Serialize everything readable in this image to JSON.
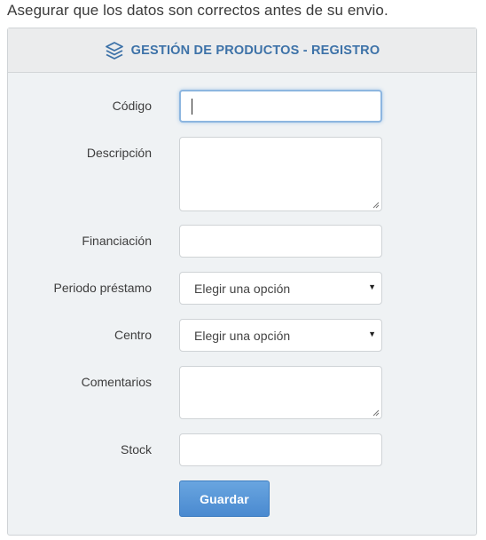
{
  "notice": "Asegurar que los datos son correctos antes de su envio.",
  "panel": {
    "title": "GESTIÓN DE PRODUCTOS - REGISTRO",
    "icon": "layers-icon"
  },
  "form": {
    "codigo_label": "Código",
    "codigo_value": "",
    "descripcion_label": "Descripción",
    "descripcion_value": "",
    "financiacion_label": "Financiación",
    "financiacion_value": "",
    "periodo_label": "Periodo préstamo",
    "periodo_selected": "Elegir una opción",
    "centro_label": "Centro",
    "centro_selected": "Elegir una opción",
    "comentarios_label": "Comentarios",
    "comentarios_value": "",
    "stock_label": "Stock",
    "stock_value": "",
    "submit_label": "Guardar"
  },
  "colors": {
    "accent": "#3d72a8",
    "button": "#5a97d8",
    "panel_bg": "#eff2f4"
  }
}
